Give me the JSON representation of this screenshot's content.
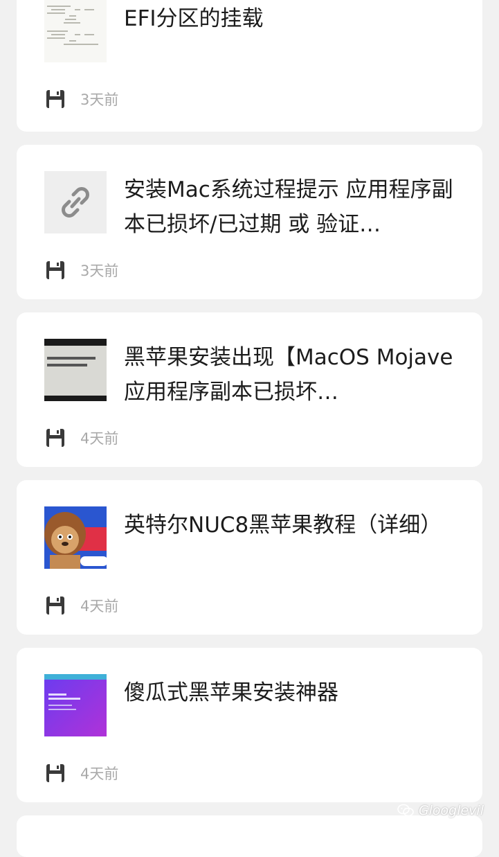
{
  "articles": [
    {
      "title": "EFI分区的挂载",
      "time": "3天前",
      "thumb": "code-screenshot"
    },
    {
      "title": "安装Mac系统过程提示 应用程序副本已损坏/已过期 或 验证…",
      "time": "3天前",
      "thumb": "link-icon"
    },
    {
      "title": "黑苹果安装出现【MacOS Mojave应用程序副本已损坏…",
      "time": "4天前",
      "thumb": "dark-dialog-screenshot"
    },
    {
      "title": "英特尔NUC8黑苹果教程（详细）",
      "time": "4天前",
      "thumb": "lion-mascot-image"
    },
    {
      "title": "傻瓜式黑苹果安装神器",
      "time": "4天前",
      "thumb": "purple-cover-image"
    }
  ],
  "watermark": {
    "text": "Glooglevil",
    "icon": "wechat-icon"
  }
}
